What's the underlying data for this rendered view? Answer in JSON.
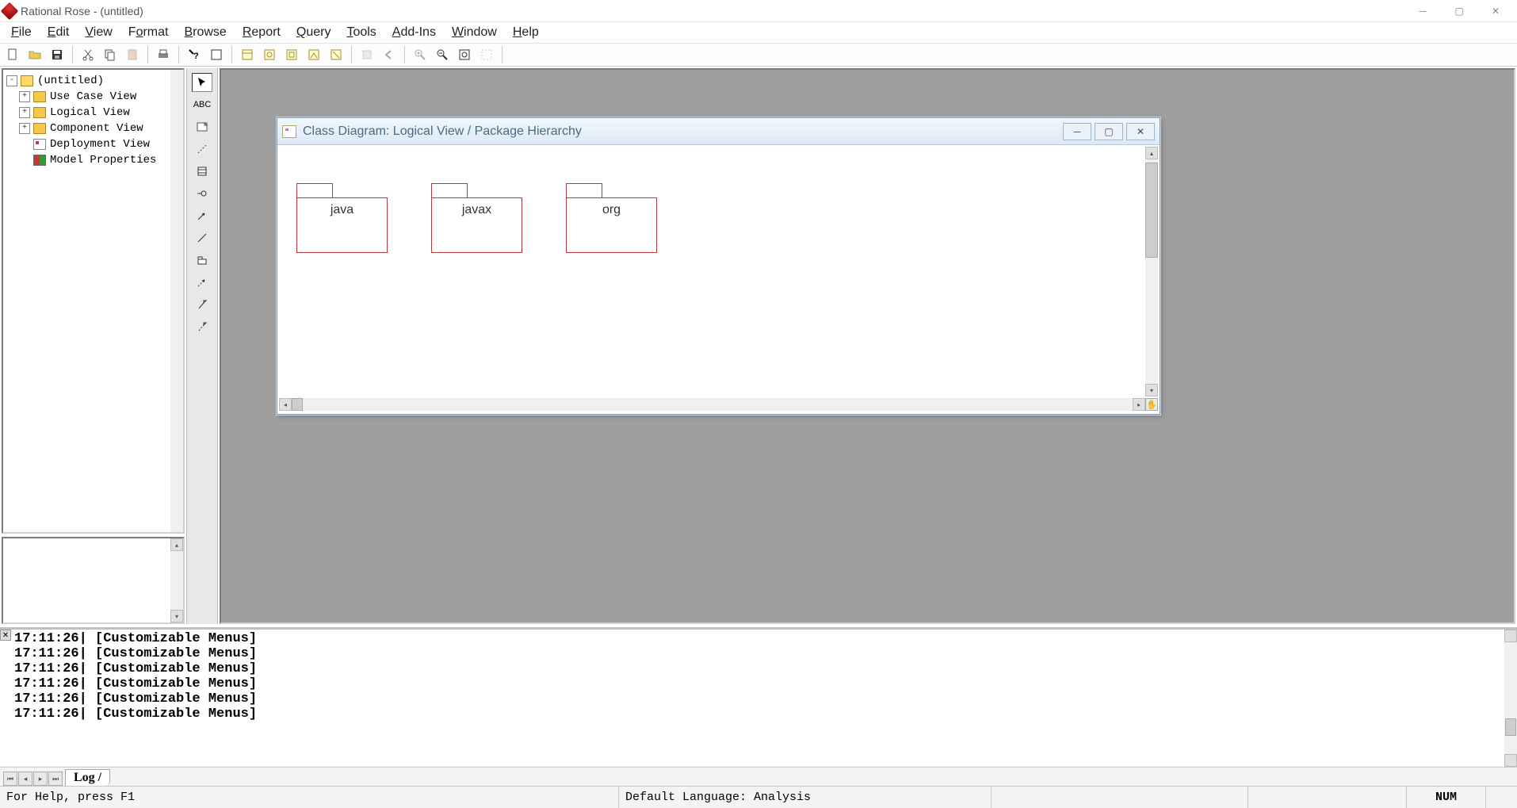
{
  "app": {
    "title": "Rational Rose - (untitled)"
  },
  "menu": {
    "file": "File",
    "edit": "Edit",
    "view": "View",
    "format": "Format",
    "browse": "Browse",
    "report": "Report",
    "query": "Query",
    "tools": "Tools",
    "addins": "Add-Ins",
    "window": "Window",
    "help": "Help"
  },
  "browser": {
    "root": "(untitled)",
    "items": [
      {
        "label": "Use Case View",
        "expandable": true
      },
      {
        "label": "Logical View",
        "expandable": true
      },
      {
        "label": "Component View",
        "expandable": true
      },
      {
        "label": "Deployment View",
        "expandable": false,
        "icon": "diagram"
      },
      {
        "label": "Model Properties",
        "expandable": false,
        "icon": "props"
      }
    ]
  },
  "toolbox_label_abc": "ABC",
  "diagram": {
    "title": "Class Diagram: Logical View / Package Hierarchy",
    "packages": [
      "java",
      "javax",
      "org"
    ]
  },
  "log": {
    "tab": "Log",
    "lines": [
      "17:11:26| [Customizable Menus]",
      "17:11:26| [Customizable Menus]",
      "17:11:26| [Customizable Menus]",
      "17:11:26| [Customizable Menus]",
      "17:11:26| [Customizable Menus]",
      "17:11:26| [Customizable Menus]"
    ]
  },
  "status": {
    "help": "For Help, press F1",
    "lang": "Default Language: Analysis",
    "num": "NUM"
  }
}
